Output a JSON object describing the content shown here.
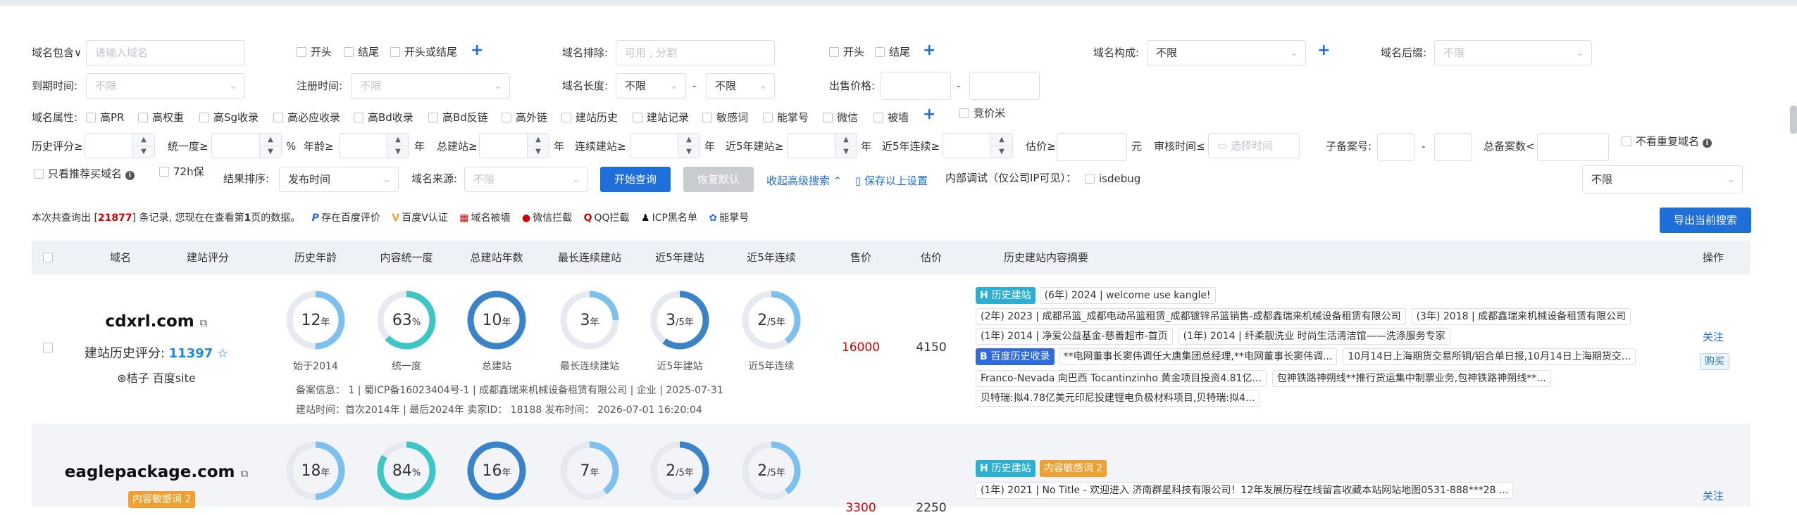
{
  "colors": {
    "primary": "#1e6fd9",
    "red": "#d40000",
    "teal": "#2bb0d3",
    "blue": "#2f6be0",
    "orange": "#f0a030",
    "ring_light": "#7cc0ef",
    "ring_teal": "#3ec5c5",
    "ring_blue": "#3a83c9",
    "ring_track": "#e6e9ef"
  },
  "filters": {
    "domain_contains_label": "域名包含∨",
    "domain_contains_placeholder": "请输入域名",
    "opt_start": "开头",
    "opt_end": "结尾",
    "opt_start_or_end": "开头或结尾",
    "domain_exclude_label": "域名排除:",
    "domain_exclude_placeholder": "可用 , 分割",
    "opt2_start": "开头",
    "opt2_end": "结尾",
    "composition_label": "域名构成:",
    "composition_value": "不限",
    "suffix_label": "域名后缀:",
    "suffix_value": "不限",
    "expire_label": "到期时间:",
    "expire_value": "不限",
    "register_label": "注册时间:",
    "register_value": "不限",
    "length_label": "域名长度:",
    "length_min": "不限",
    "length_dash": "-",
    "length_max": "不限",
    "price_label": "出售价格:",
    "price_dash": "-",
    "attr_label": "域名属性:",
    "attrs": [
      "高PR",
      "高权重",
      "高Sg收录",
      "高必应收录",
      "高Bd收录",
      "高Bd反链",
      "高外链",
      "建站历史",
      "建站记录",
      "敏感词",
      "能掌号",
      "微信",
      "被墙"
    ],
    "bid_label": "竞价米",
    "history_score_label": "历史评分≥",
    "unity_label": "统一度≥",
    "pct": "%",
    "age_label": "年龄≥",
    "year": "年",
    "total_sites_label": "总建站≥",
    "year2": "年",
    "consec_label": "连续建站≥",
    "year3": "年",
    "recent5_label": "近5年建站≥",
    "year4": "年",
    "recent5c_label": "近5年连续≥",
    "valuation_label": "估价≥",
    "yuan": "元",
    "review_label": "审核时间≤",
    "review_placeholder": "选择时间",
    "sub_icp_label": "子备案号:",
    "sub_icp_dash": "-",
    "total_icp_label": "总备案数<",
    "no_dup_label": "不看重复域名",
    "recommend_label": "只看推荐买域名",
    "hold72_label": "72h保",
    "sort_label": "结果排序:",
    "sort_value": "发布时间",
    "source_label": "域名来源:",
    "source_value": "不限",
    "search_btn": "开始查询",
    "reset_btn": "恢复默认",
    "collapse_link": "收起高级搜索",
    "save_link": "保存以上设置",
    "debug_label": "内部调试（仅公司IP可见）：",
    "isdebug": "isdebug",
    "right_select": "不限"
  },
  "summary": {
    "prefix": "本次共查询出 [",
    "count": "21877",
    "mid": "] 条记录, 您现在在查看第",
    "page": "1",
    "suffix": "页的数据。",
    "legends": [
      "存在百度评价",
      "百度V认证",
      "域名被墙",
      "微信拦截",
      "QQ拦截",
      "ICP黑名单",
      "能掌号"
    ],
    "export_btn": "导出当前搜索"
  },
  "table": {
    "headers": [
      "域名",
      "建站评分",
      "历史年龄",
      "内容统一度",
      "总建站年数",
      "最长连续建站",
      "近5年建站",
      "近5年连续",
      "售价",
      "估价",
      "历史建站内容摘要",
      "操作"
    ]
  },
  "rows": [
    {
      "domain": "cdxrl.com",
      "score_label": "建站历史评分:",
      "score": "11397",
      "star": "☆",
      "extra": "⊛桔子  百度site",
      "rings": [
        {
          "val": "12",
          "unit": "年",
          "cap": "始于2014",
          "pct": 0.5
        },
        {
          "val": "63",
          "unit": "%",
          "cap": "统一度",
          "pct": 0.63
        },
        {
          "val": "10",
          "unit": "年",
          "cap": "总建站",
          "pct": 1.0
        },
        {
          "val": "3",
          "unit": "年",
          "cap": "最长连续建站",
          "pct": 0.25
        },
        {
          "val": "3",
          "unit": "/5年",
          "cap": "近5年建站",
          "pct": 0.6
        },
        {
          "val": "2",
          "unit": "/5年",
          "cap": "近5年连续",
          "pct": 0.4
        }
      ],
      "price": "16000",
      "valuation": "4150",
      "icp": "备案信息：  1 | 蜀ICP备16023404号-1 | 成都鑫瑞来机械设备租赁有限公司 | 企业 | 2025-07-31",
      "site_time": "建站时间：首次2014年 | 最后2024年    卖家ID：  18188    发布时间：  2026-07-01 16:20:04",
      "history_badge": "历史建站",
      "history_chips": [
        "(6年) 2024 | welcome use kangle!"
      ],
      "chips2": [
        "(2年) 2023 | 成都吊篮_成都电动吊篮租赁_成都镀锌吊篮销售-成都鑫瑞来机械设备租赁有限公司",
        "(3年) 2018 | 成都鑫瑞来机械设备租赁有限公司"
      ],
      "chips3": [
        "(1年) 2014 | 净爱公益基金-慈善超市-首页",
        "(1年) 2014 | 纤柔靓洗业 时尚生活清洁馆——洗涤服务专家"
      ],
      "baidu_badge": "百度历史收录",
      "baidu_chips": [
        "**电网董事长窦伟调任大唐集团总经理,**电网董事长窦伟调...",
        "10月14日上海期货交易所铜/铝合单日报,10月14日上海期货交..."
      ],
      "chips5": [
        "Franco-Nevada 向巴西 Tocantinzinho 黄金项目投资4.81亿...",
        "包神铁路神朔线**推行货运集中制票业务,包神铁路神朔线**..."
      ],
      "chips6": [
        "贝特瑞:拟4.78亿美元印尼投建锂电负极材料项目,贝特瑞:拟4..."
      ],
      "op_follow": "关注",
      "op_buy": "购买"
    },
    {
      "domain": "eaglepackage.com",
      "sensitive": "内容敏感词 2",
      "rings": [
        {
          "val": "18",
          "unit": "年",
          "pct": 0.5
        },
        {
          "val": "84",
          "unit": "%",
          "pct": 0.84
        },
        {
          "val": "16",
          "unit": "年",
          "pct": 1.0
        },
        {
          "val": "7",
          "unit": "年",
          "pct": 0.4
        },
        {
          "val": "2",
          "unit": "/5年",
          "pct": 0.4
        },
        {
          "val": "2",
          "unit": "/5年",
          "pct": 0.4
        }
      ],
      "price": "3300",
      "valuation": "2250",
      "history_badge": "历史建站",
      "sensitive_badge": "内容敏感词 2",
      "chips2": [
        "(1年) 2021 | No Title - 欢迎进入 济南群星科技有限公司！12年发展历程在线留言收藏本站网站地图0531-888***28 ..."
      ],
      "op_follow": "关注"
    }
  ]
}
